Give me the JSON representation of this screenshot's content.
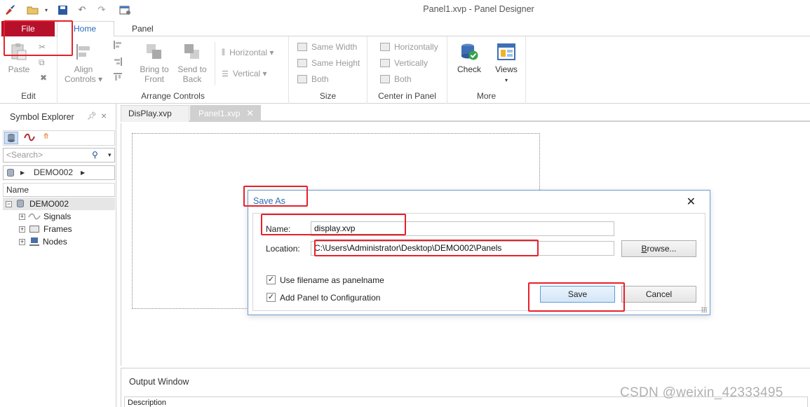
{
  "window": {
    "title": "Panel1.xvp - Panel Designer"
  },
  "ribbon_tabs": {
    "file": "File",
    "home": "Home",
    "panel": "Panel"
  },
  "ribbon": {
    "edit": {
      "label": "Edit",
      "paste": "Paste"
    },
    "arrange": {
      "label": "Arrange Controls",
      "align": "Align",
      "align2": "Controls ▾",
      "bring": "Bring to",
      "bring2": "Front",
      "send": "Send to",
      "send2": "Back",
      "horizontal": "Horizontal ▾",
      "vertical": "Vertical ▾"
    },
    "size": {
      "label": "Size",
      "same_width": "Same Width",
      "same_height": "Same Height",
      "both": "Both"
    },
    "center": {
      "label": "Center in Panel",
      "horizontally": "Horizontally",
      "vertically": "Vertically",
      "both": "Both"
    },
    "more": {
      "label": "More",
      "check": "Check",
      "views": "Views",
      "views_arrow": "▾"
    }
  },
  "explorer": {
    "title": "Symbol Explorer",
    "search_placeholder": "<Search>",
    "breadcrumb": "DEMO002",
    "column": "Name",
    "tree": [
      {
        "label": "DEMO002"
      },
      {
        "label": "Signals"
      },
      {
        "label": "Frames"
      },
      {
        "label": "Nodes"
      }
    ]
  },
  "doc_tabs": [
    "DisPlay.xvp",
    "Panel1.xvp"
  ],
  "output": {
    "title": "Output Window",
    "column": "Description"
  },
  "dialog": {
    "title": "Save As",
    "name_label": "Name:",
    "name_value": "display.xvp",
    "location_label": "Location:",
    "location_value": "C:\\Users\\Administrator\\Desktop\\DEMO002\\Panels",
    "browse": "Browse...",
    "check1": "Use filename as panelname",
    "check2": "Add Panel to Configuration",
    "save": "Save",
    "cancel": "Cancel"
  },
  "watermark": "CSDN @weixin_42333495",
  "colors": {
    "file_tab": "#b7102b",
    "accent": "#2b6cb4",
    "annotation": "#e8202a"
  }
}
